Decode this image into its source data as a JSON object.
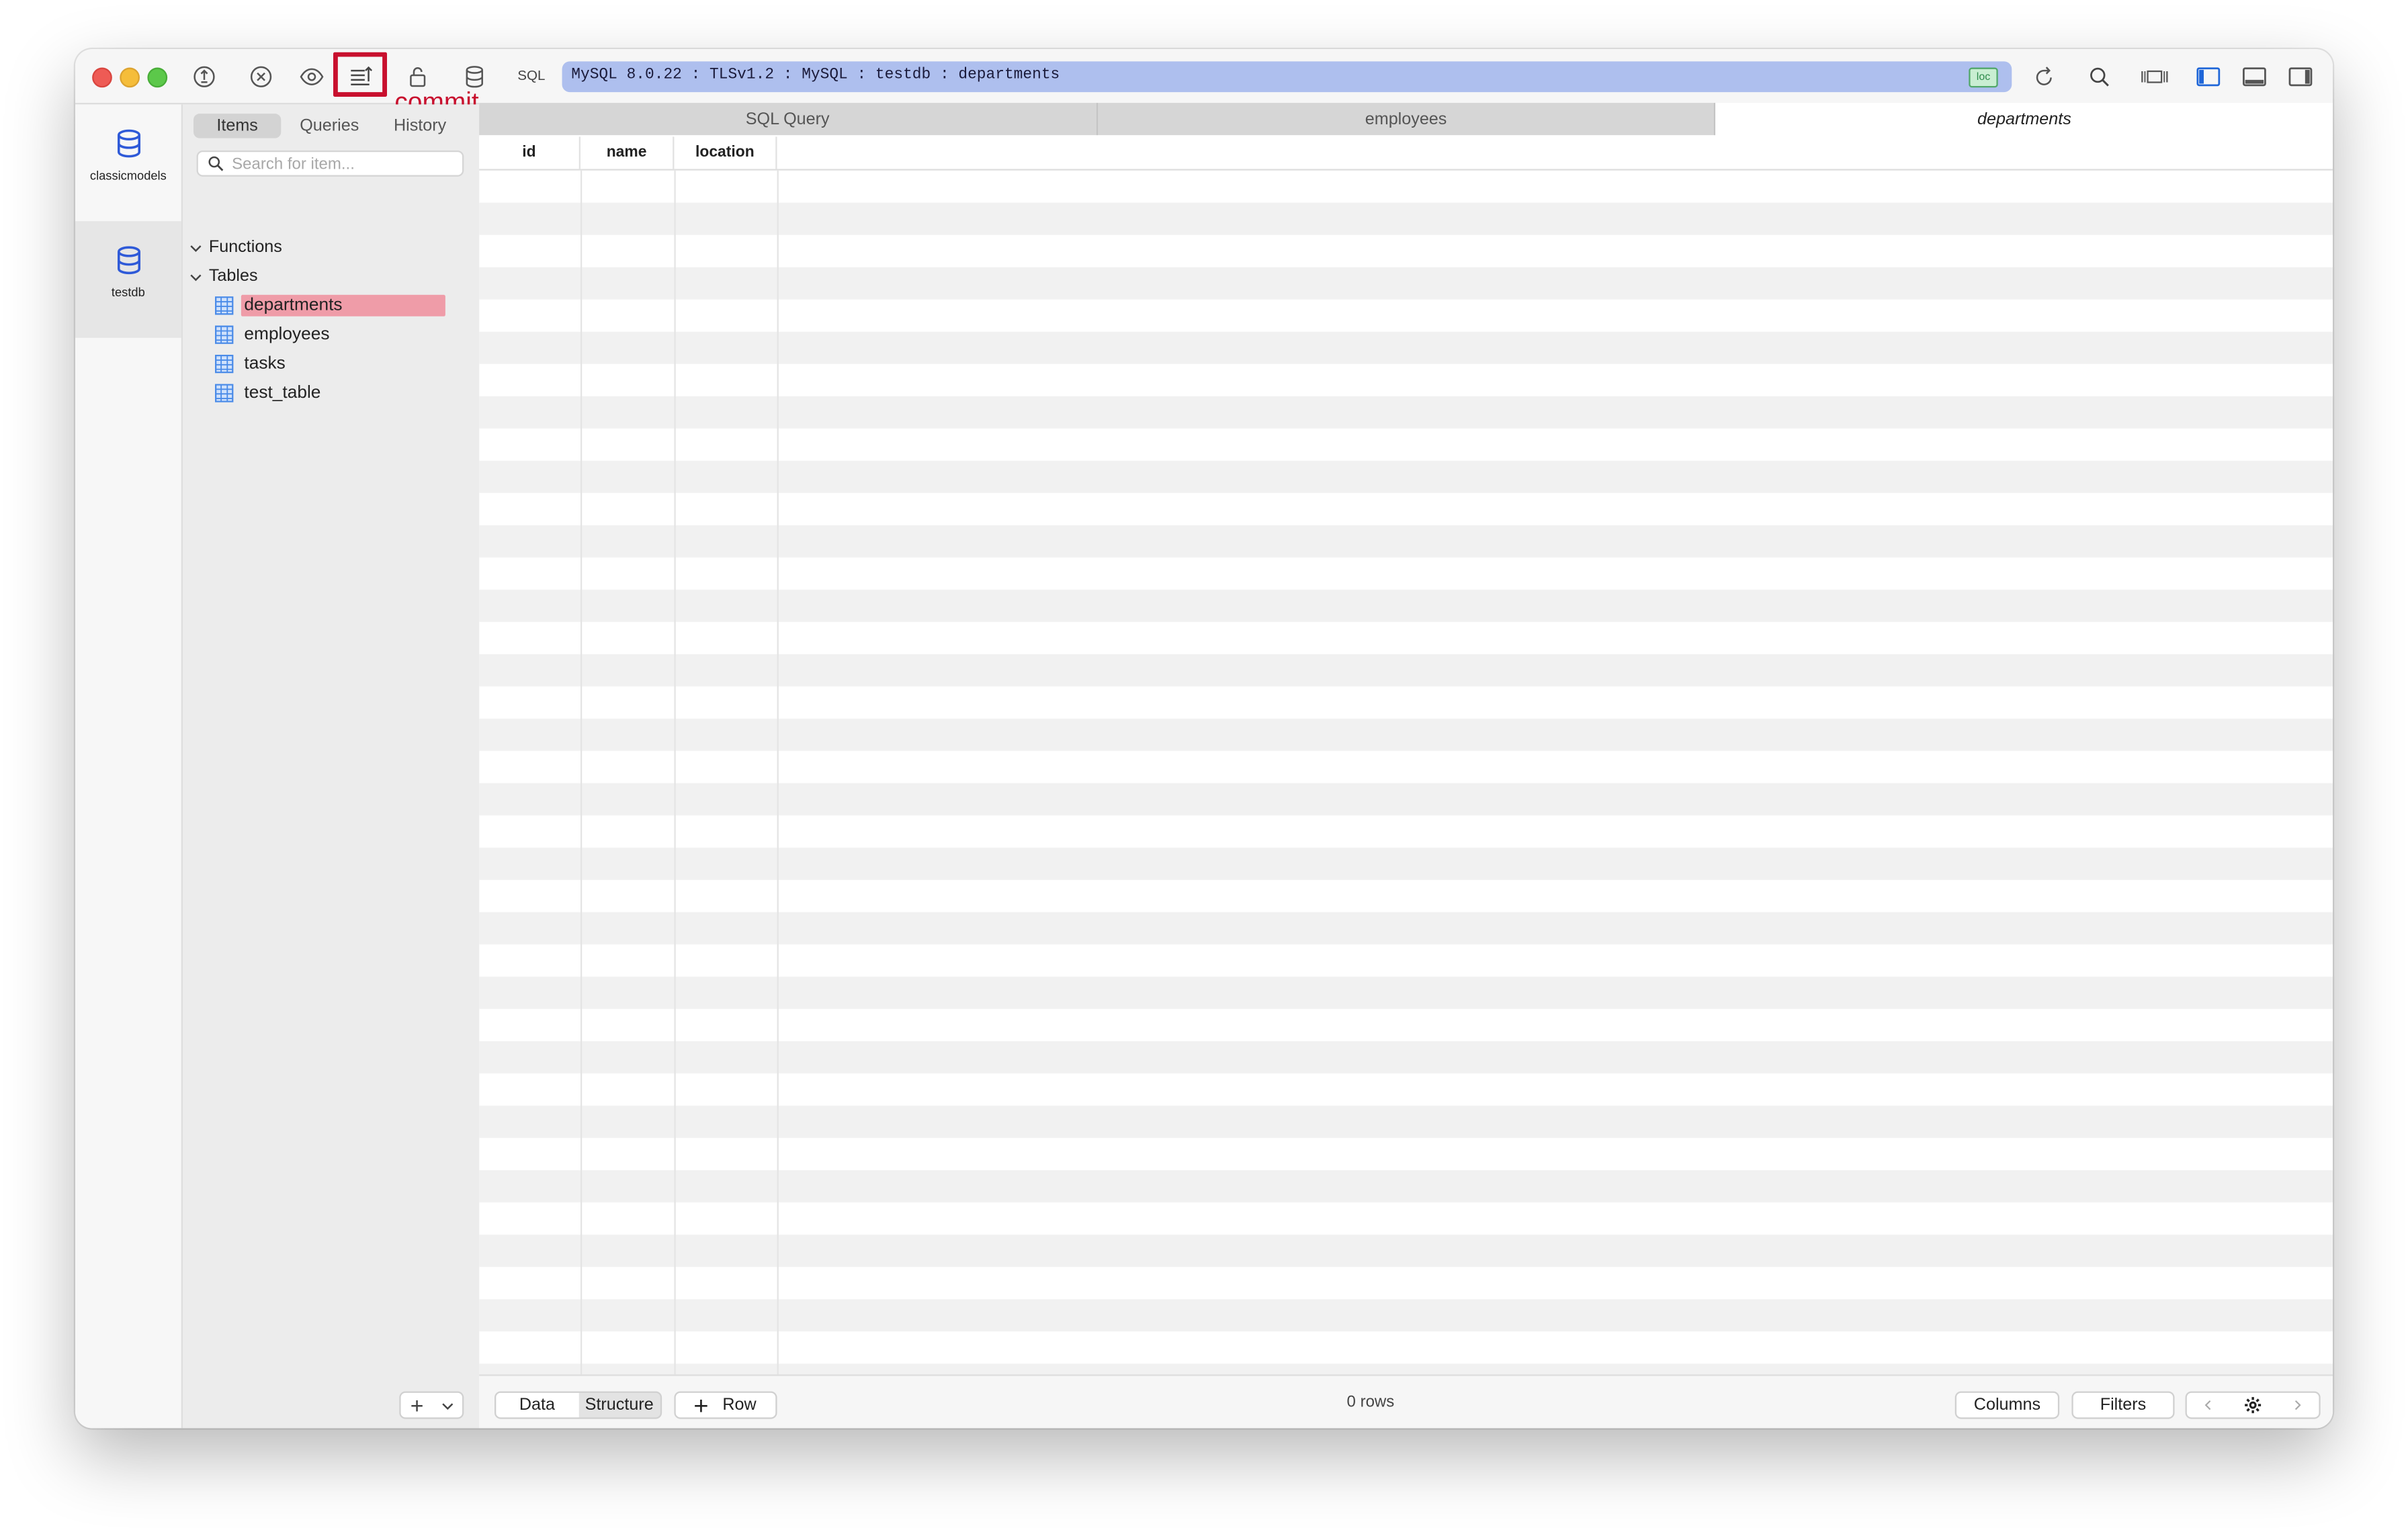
{
  "toolbar": {
    "annotation_label": "commit",
    "sql_label": "SQL",
    "connection_text": "MySQL 8.0.22 : TLSv1.2 : MySQL : testdb : departments",
    "connection_badge": "loc",
    "icons": [
      "connection-icon",
      "stop-icon",
      "preview-icon",
      "commit-icon",
      "lock-icon",
      "database-icon",
      "refresh-icon",
      "search-icon",
      "layout-columns-icon",
      "toggle-left-panel-icon",
      "toggle-bottom-panel-icon",
      "toggle-right-panel-icon"
    ]
  },
  "databases": [
    {
      "label": "classicmodels",
      "active": false
    },
    {
      "label": "testdb",
      "active": true
    }
  ],
  "sidebar": {
    "tabs": [
      "Items",
      "Queries",
      "History"
    ],
    "active_tab": "Items",
    "search_placeholder": "Search for item...",
    "groups": [
      {
        "label": "Functions"
      },
      {
        "label": "Tables"
      }
    ],
    "tables": [
      "departments",
      "employees",
      "tasks",
      "test_table"
    ],
    "selected_table": "departments"
  },
  "tabs": [
    {
      "label": "SQL Query",
      "active": false
    },
    {
      "label": "employees",
      "active": false
    },
    {
      "label": "departments",
      "active": true
    }
  ],
  "grid": {
    "columns": [
      "id",
      "name",
      "location"
    ]
  },
  "bottom": {
    "view_tabs": [
      "Data",
      "Structure"
    ],
    "active_view": "Data",
    "add_row_label": "Row",
    "row_count": "0 rows",
    "columns_button": "Columns",
    "filters_button": "Filters"
  },
  "colors": {
    "connection_bar": "#aebfee",
    "selected_item": "#ef9ca8",
    "annotation": "#c8102e",
    "db_icon": "#2f5ad8"
  }
}
